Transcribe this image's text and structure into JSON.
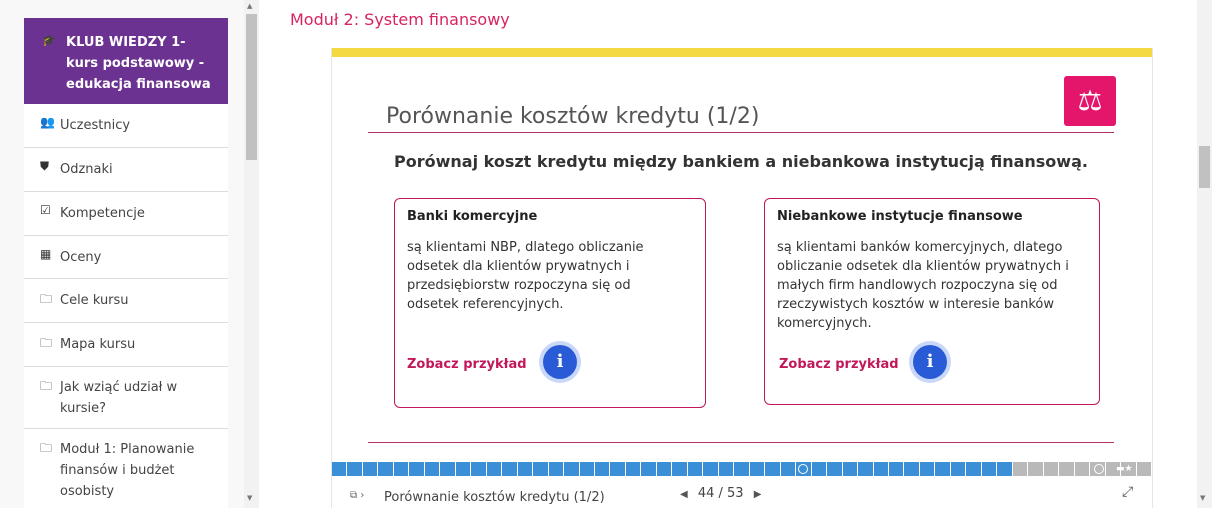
{
  "sidebar": {
    "course_icon": "graduation-cap-icon",
    "course_title": "KLUB WIEDZY 1- kurs podstawowy - edukacja finansowa",
    "items": [
      {
        "icon": "users-icon",
        "glyph": "👥",
        "label": "Uczestnicy"
      },
      {
        "icon": "shield-icon",
        "glyph": "⛊",
        "label": "Odznaki"
      },
      {
        "icon": "checkbox-icon",
        "glyph": "☑",
        "label": "Kompetencje"
      },
      {
        "icon": "table-icon",
        "glyph": "▦",
        "label": "Oceny"
      },
      {
        "icon": "folder-icon",
        "glyph": "🗀",
        "label": "Cele kursu"
      },
      {
        "icon": "folder-icon",
        "glyph": "🗀",
        "label": "Mapa kursu"
      },
      {
        "icon": "folder-icon",
        "glyph": "🗀",
        "label": "Jak wziąć udział w kursie?"
      },
      {
        "icon": "folder-icon",
        "glyph": "🗀",
        "label": "Moduł 1: Planowanie finansów i budżet osobisty"
      }
    ]
  },
  "main": {
    "module_title": "Moduł 2: System finansowy"
  },
  "slide": {
    "badge_icon": "scales-icon",
    "title": "Porównanie kosztów kredytu (1/2)",
    "instruction": "Porównaj koszt kredytu między bankiem a niebankowa instytucją finansową.",
    "boxes": [
      {
        "heading": "Banki komercyjne",
        "text": "są klientami NBP, dlatego obliczanie odsetek dla klientów prywatnych i przedsiębiorstw rozpoczyna się od odsetek referencyjnych.",
        "link": "Zobacz przykład",
        "info_icon": "info-icon"
      },
      {
        "heading": "Niebankowe instytucje finansowe",
        "text": "są klientami banków komercyjnych, dlatego obliczanie odsetek dla klientów prywatnych i małych firm handlowych rozpoczyna się od rzeczywistych kosztów w interesie banków komercyjnych.",
        "link": "Zobacz przykład",
        "info_icon": "info-icon"
      }
    ]
  },
  "progress": {
    "current": 44,
    "total": 53,
    "done_color": "#3b8fd6",
    "todo_color": "#b9b9b9"
  },
  "footer": {
    "menu_icon": "slides-menu-icon",
    "slide_name": "Porównanie kosztów kredytu (1/2)",
    "page": "44 / 53",
    "expand_icon": "expand-icon"
  }
}
